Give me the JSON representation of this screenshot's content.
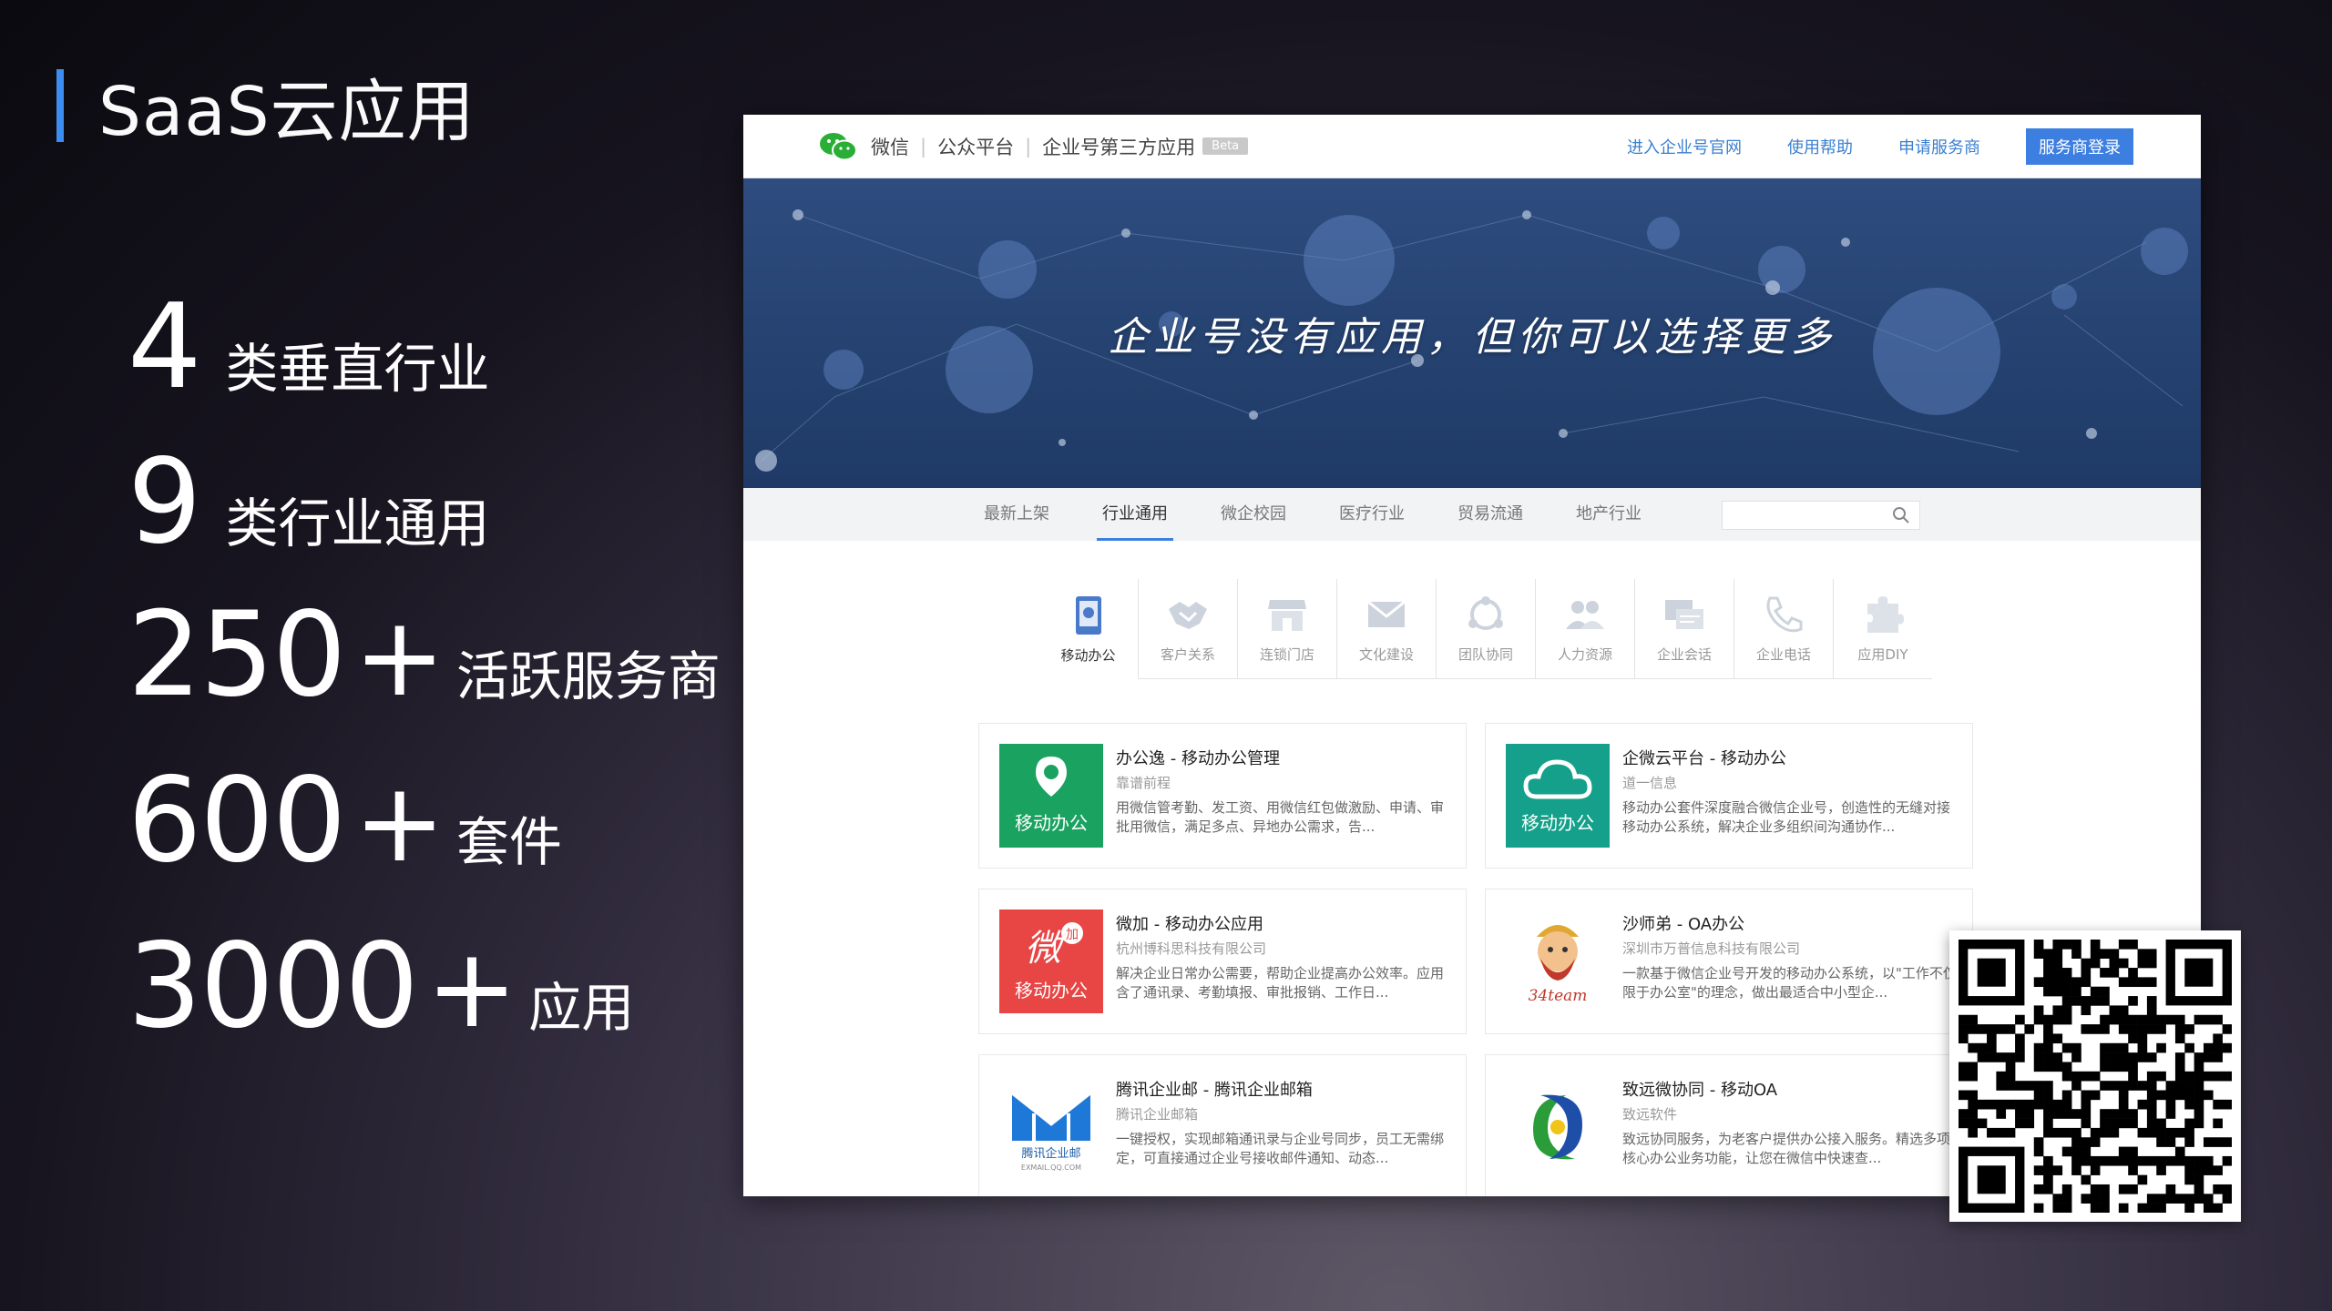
{
  "slide": {
    "title": "SaaS云应用",
    "stats": [
      {
        "number": "4",
        "plus": "",
        "label": "类垂直行业"
      },
      {
        "number": "9",
        "plus": "",
        "label": "类行业通用"
      },
      {
        "number": "250",
        "plus": "+",
        "label": "活跃服务商"
      },
      {
        "number": "600",
        "plus": "+",
        "label": "套件"
      },
      {
        "number": "3000",
        "plus": "+",
        "label": "应用"
      }
    ]
  },
  "header": {
    "brand_wechat": "微信",
    "brand_sep": "|",
    "brand_platform": "公众平台",
    "brand_section": "企业号第三方应用",
    "beta": "Beta",
    "links": [
      "进入企业号官网",
      "使用帮助",
      "申请服务商"
    ],
    "login": "服务商登录"
  },
  "banner": {
    "slogan": "企业号没有应用，但你可以选择更多"
  },
  "tabs": [
    {
      "label": "最新上架",
      "active": false
    },
    {
      "label": "行业通用",
      "active": true
    },
    {
      "label": "微企校园",
      "active": false
    },
    {
      "label": "医疗行业",
      "active": false
    },
    {
      "label": "贸易流通",
      "active": false
    },
    {
      "label": "地产行业",
      "active": false
    }
  ],
  "search": {
    "placeholder": "",
    "icon": "search-icon"
  },
  "categories": [
    {
      "label": "移动办公",
      "icon": "phone-icon",
      "active": true
    },
    {
      "label": "客户关系",
      "icon": "handshake-icon",
      "active": false
    },
    {
      "label": "连锁门店",
      "icon": "store-icon",
      "active": false
    },
    {
      "label": "文化建设",
      "icon": "envelope-icon",
      "active": false
    },
    {
      "label": "团队协同",
      "icon": "team-icon",
      "active": false
    },
    {
      "label": "人力资源",
      "icon": "people-icon",
      "active": false
    },
    {
      "label": "企业会话",
      "icon": "chat-icon",
      "active": false
    },
    {
      "label": "企业电话",
      "icon": "telephone-icon",
      "active": false
    },
    {
      "label": "应用DIY",
      "icon": "puzzle-icon",
      "active": false
    }
  ],
  "apps": [
    {
      "name": "办公逸 - 移动办公管理",
      "company": "靠谱前程",
      "desc": "用微信管考勤、发工资、用微信红包做激励、申请、审批用微信，满足多点、异地办公需求，告...",
      "icon_text": "移动办公",
      "color": "#1aa260"
    },
    {
      "name": "企微云平台 - 移动办公",
      "company": "道一信息",
      "desc": "移动办公套件深度融合微信企业号，创造性的无缝对接移动办公系统，解决企业多组织间沟通协作...",
      "icon_text": "移动办公",
      "color": "#14a08a"
    },
    {
      "name": "微加 - 移动办公应用",
      "company": "杭州博科思科技有限公司",
      "desc": "解决企业日常办公需要，帮助企业提高办公效率。应用含了通讯录、考勤填报、审批报销、工作日...",
      "icon_text": "移动办公",
      "icon_top": "微",
      "icon_badge": "加",
      "color": "#e84545"
    },
    {
      "name": "沙师弟 - OA办公",
      "company": "深圳市万普信息科技有限公司",
      "desc": "一款基于微信企业号开发的移动办公系统，以\"工作不仅限于办公室\"的理念，做出最适合中小型企...",
      "icon_text": "34team",
      "color": "#ffffff"
    },
    {
      "name": "腾讯企业邮 - 腾讯企业邮箱",
      "company": "腾讯企业邮箱",
      "desc": "一键授权，实现邮箱通讯录与企业号同步，员工无需绑定，可直接通过企业号接收邮件通知、动态...",
      "icon_text": "腾讯企业邮",
      "icon_sub": "EXMAIL.QQ.COM",
      "color": "#ffffff"
    },
    {
      "name": "致远微协同 - 移动OA",
      "company": "致远软件",
      "desc": "致远协同服务，为老客户提供办公接入服务。精选多项核心办公业务功能，让您在微信中快速查...",
      "icon_text": "",
      "color": "#ffffff"
    }
  ],
  "qr": {
    "icon": "qr-code-icon"
  }
}
